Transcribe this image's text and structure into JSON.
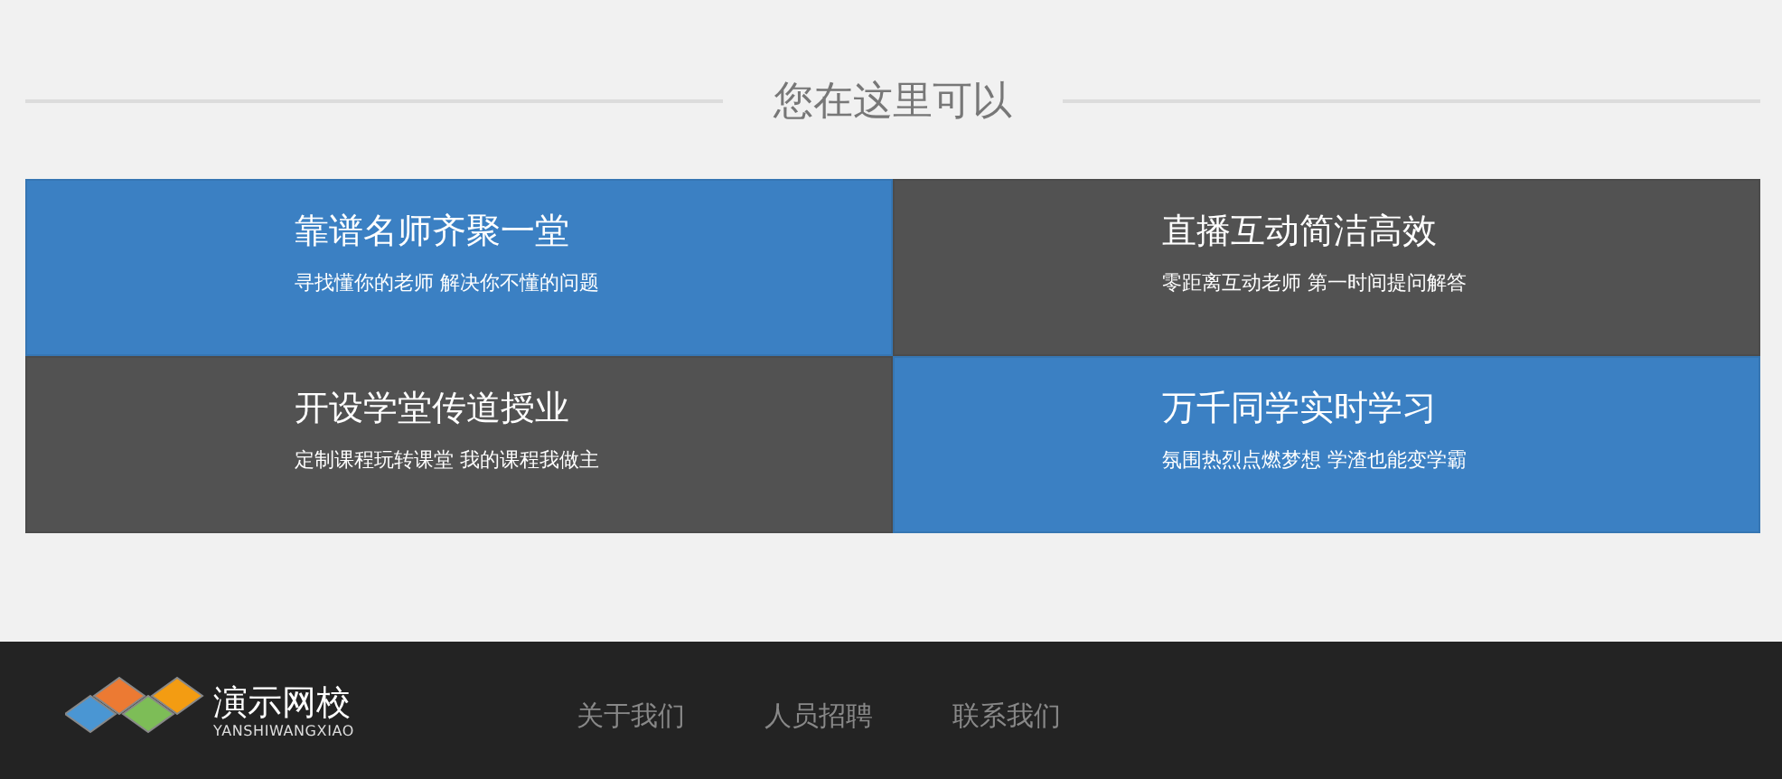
{
  "section_title": "您在这里可以",
  "features": [
    {
      "title": "靠谱名师齐聚一堂",
      "subtitle": "寻找懂你的老师 解决你不懂的问题",
      "color": "#3b80c3"
    },
    {
      "title": "直播互动简洁高效",
      "subtitle": "零距离互动老师 第一时间提问解答",
      "color": "#525252"
    },
    {
      "title": "开设学堂传道授业",
      "subtitle": "定制课程玩转课堂 我的课程我做主",
      "color": "#525252"
    },
    {
      "title": "万千同学实时学习",
      "subtitle": "氛围热烈点燃梦想 学渣也能变学霸",
      "color": "#3b80c3"
    }
  ],
  "footer": {
    "logo": {
      "name": "演示网校",
      "pinyin": "YANSHIWANGXIAO"
    },
    "links": [
      "关于我们",
      "人员招聘",
      "联系我们"
    ]
  }
}
